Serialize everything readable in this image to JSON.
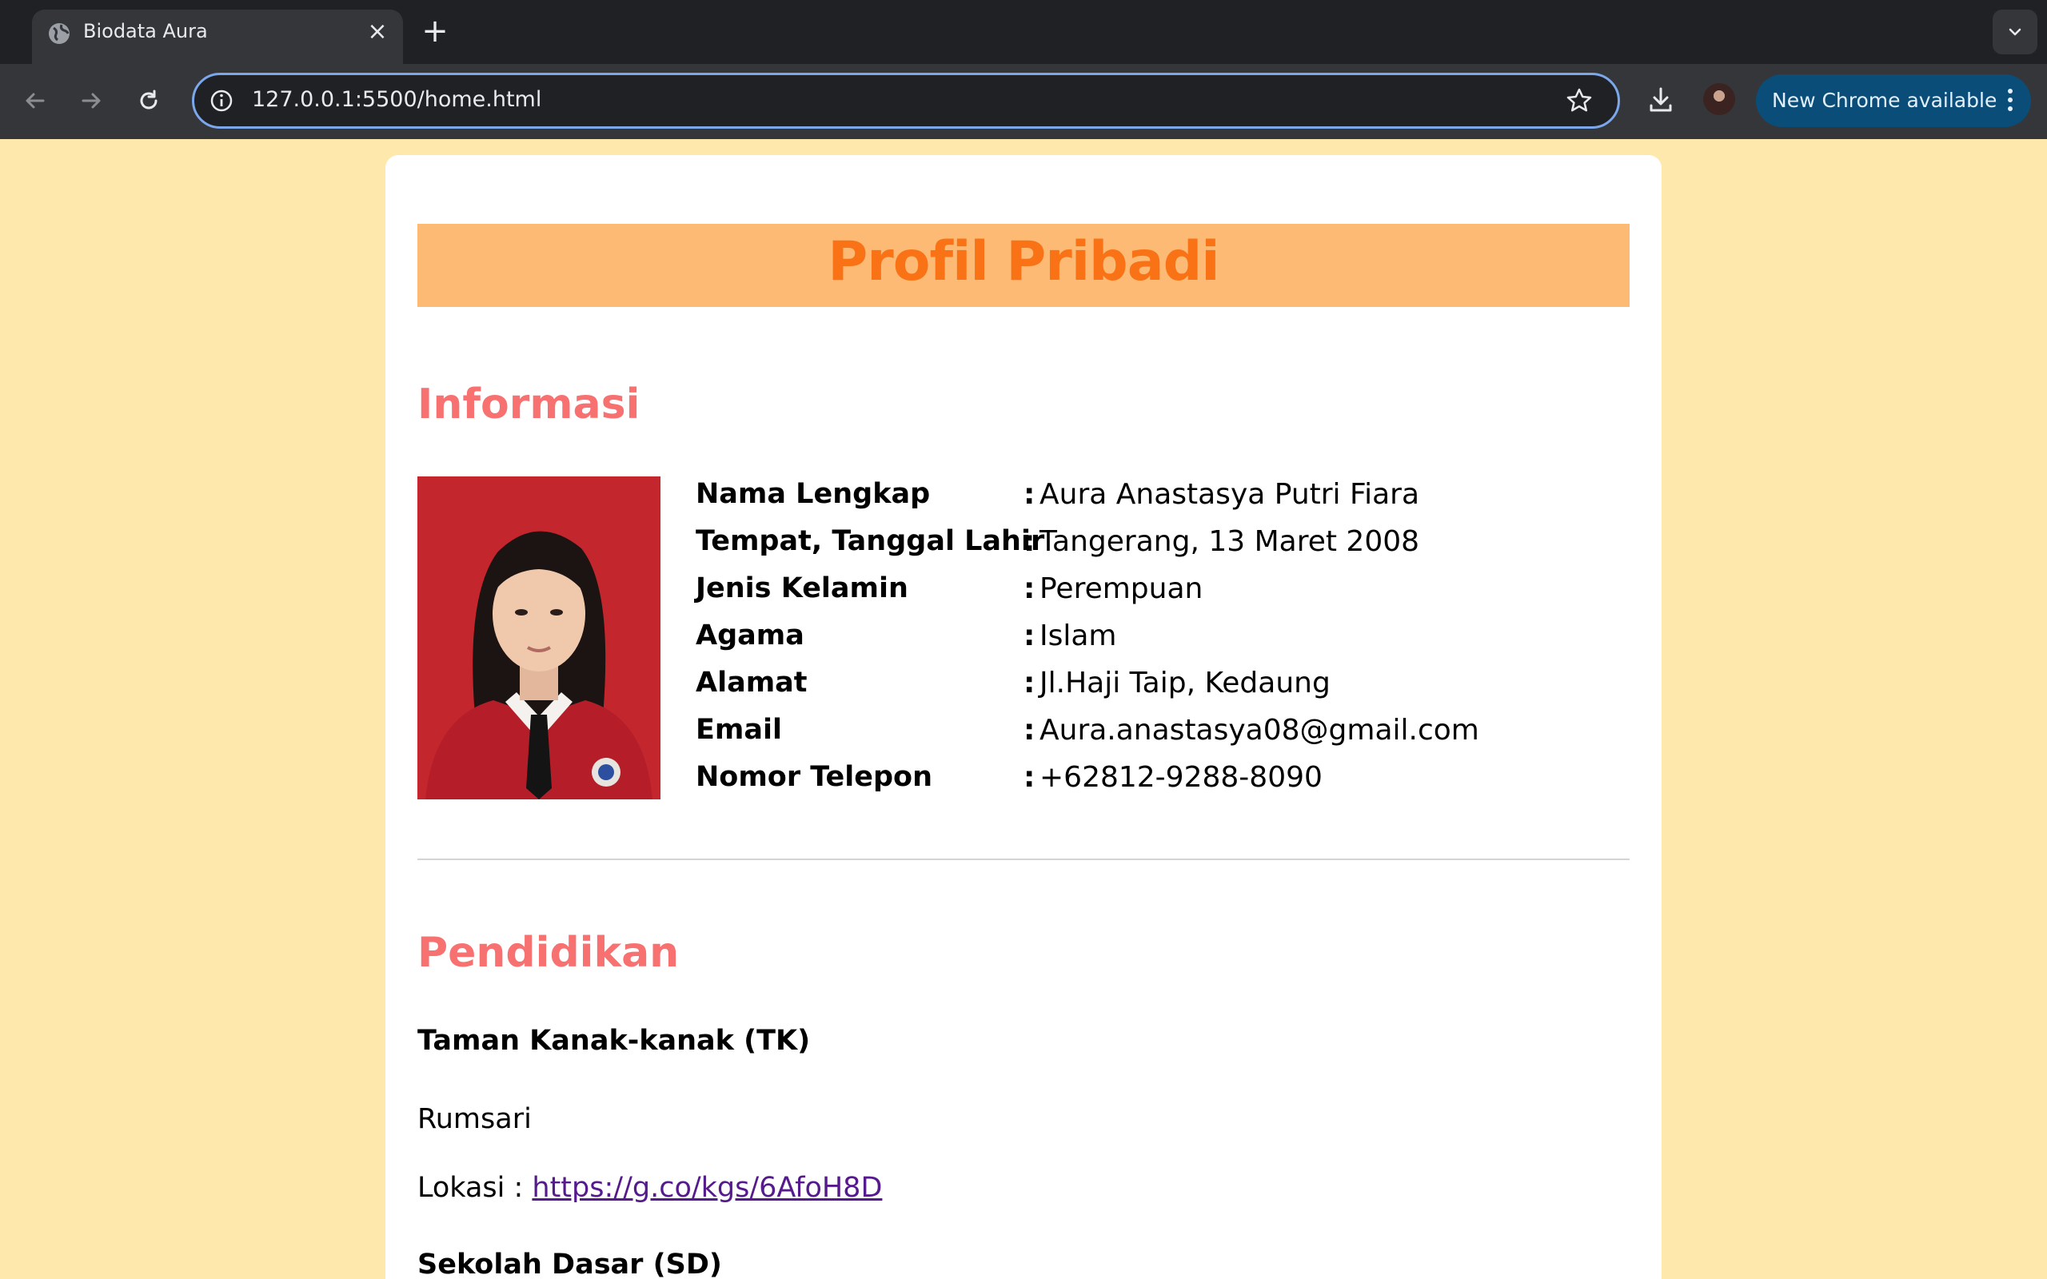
{
  "browser": {
    "tab_title": "Biodata Aura",
    "url": "127.0.0.1:5500/home.html",
    "update_label": "New Chrome available"
  },
  "page": {
    "banner_title": "Profil Pribadi",
    "informasi": {
      "heading": "Informasi",
      "rows": [
        {
          "label": "Nama Lengkap",
          "sep": ":",
          "value": "Aura Anastasya Putri Fiara"
        },
        {
          "label": "Tempat, Tanggal Lahir",
          "sep": ":",
          "value": "Tangerang, 13 Maret 2008"
        },
        {
          "label": "Jenis Kelamin",
          "sep": ":",
          "value": "Perempuan"
        },
        {
          "label": "Agama",
          "sep": ":",
          "value": "Islam"
        },
        {
          "label": "Alamat",
          "sep": ":",
          "value": "Jl.Haji Taip, Kedaung"
        },
        {
          "label": "Email",
          "sep": ":",
          "value": "Aura.anastasya08@gmail.com"
        },
        {
          "label": "Nomor Telepon",
          "sep": ":",
          "value": "+62812-9288-8090"
        }
      ]
    },
    "pendidikan": {
      "heading": "Pendidikan",
      "tk": {
        "title": "Taman Kanak-kanak (TK)",
        "school": "Rumsari",
        "location_label": "Lokasi : ",
        "location_link": "https://g.co/kgs/6AfoH8D"
      },
      "sd": {
        "title": "Sekolah Dasar (SD)"
      }
    }
  }
}
